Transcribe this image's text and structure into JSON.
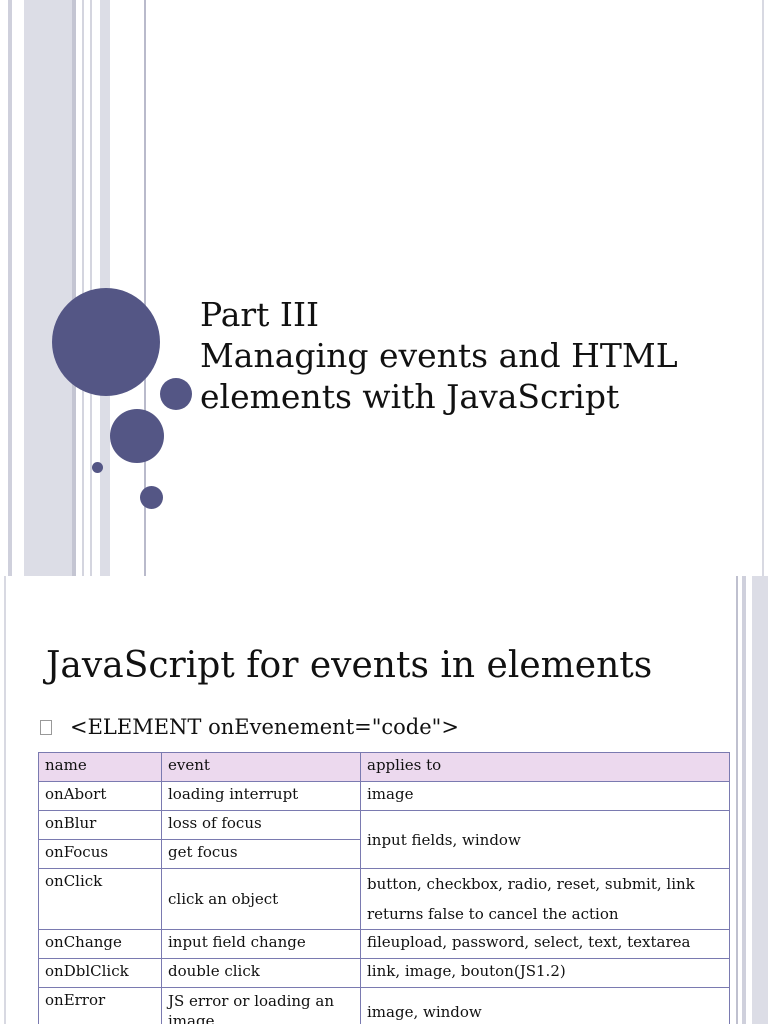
{
  "slide1": {
    "title_lines": [
      "Part III",
      "Managing events and HTML",
      "elements with JavaScript"
    ]
  },
  "slide2": {
    "title": "JavaScript for events in elements",
    "bullet": "<ELEMENT onEvenement=\"code\">",
    "table": {
      "headers": [
        "name",
        "event",
        "applies to"
      ],
      "rows": [
        {
          "name": "onAbort",
          "event": "loading interrupt",
          "applies": "image"
        },
        {
          "name": "onBlur",
          "event": "loss of focus",
          "applies": "input fields, window"
        },
        {
          "name": "onFocus",
          "event": "get focus",
          "applies": ""
        },
        {
          "name": "onClick",
          "event": "click an object",
          "applies": "button, checkbox, radio, reset, submit, link",
          "applies_note": "returns false to cancel the action"
        },
        {
          "name": "onChange",
          "event": "input field change",
          "applies": "fileupload, password, select, text, textarea"
        },
        {
          "name": "onDblClick",
          "event": "double click",
          "applies": "link, image, bouton(JS1.2)"
        },
        {
          "name": "onError",
          "event": "JS error or loading an image",
          "applies": "image, window"
        }
      ]
    }
  },
  "colors": {
    "accent": "#545685",
    "header_bg": "#ecd9ee",
    "table_border": "#7a7ab0"
  }
}
